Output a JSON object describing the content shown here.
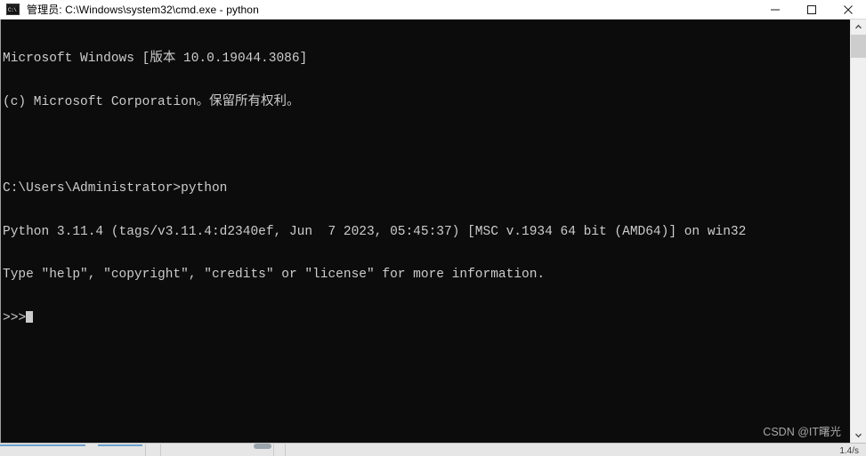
{
  "window": {
    "title": "管理员: C:\\Windows\\system32\\cmd.exe - python",
    "icon_name": "cmd-exe-icon",
    "icon_glyph": "C:\\",
    "controls": {
      "minimize_label": "最小化",
      "maximize_label": "最大化",
      "close_label": "关闭"
    }
  },
  "console": {
    "background_color": "#0c0c0c",
    "text_color": "#cccccc",
    "lines": [
      "Microsoft Windows [版本 10.0.19044.3086]",
      "(c) Microsoft Corporation。保留所有权利。",
      "",
      "C:\\Users\\Administrator>python",
      "Python 3.11.4 (tags/v3.11.4:d2340ef, Jun  7 2023, 05:45:37) [MSC v.1934 64 bit (AMD64)] on win32",
      "Type \"help\", \"copyright\", \"credits\" or \"license\" for more information.",
      ">>>"
    ],
    "prompt": ">>>",
    "cursor_visible": true
  },
  "scrollbar": {
    "up_arrow_label": "向上滚动",
    "down_arrow_label": "向下滚动",
    "thumb_label": "滚动条滑块"
  },
  "watermark": {
    "text": "CSDN @IT曙光"
  },
  "taskbar": {
    "clock_text": "1.4/s",
    "items": [
      {
        "name": "taskbar-item-1"
      },
      {
        "name": "taskbar-item-2"
      },
      {
        "name": "taskbar-item-3"
      },
      {
        "name": "taskbar-item-4"
      }
    ]
  }
}
